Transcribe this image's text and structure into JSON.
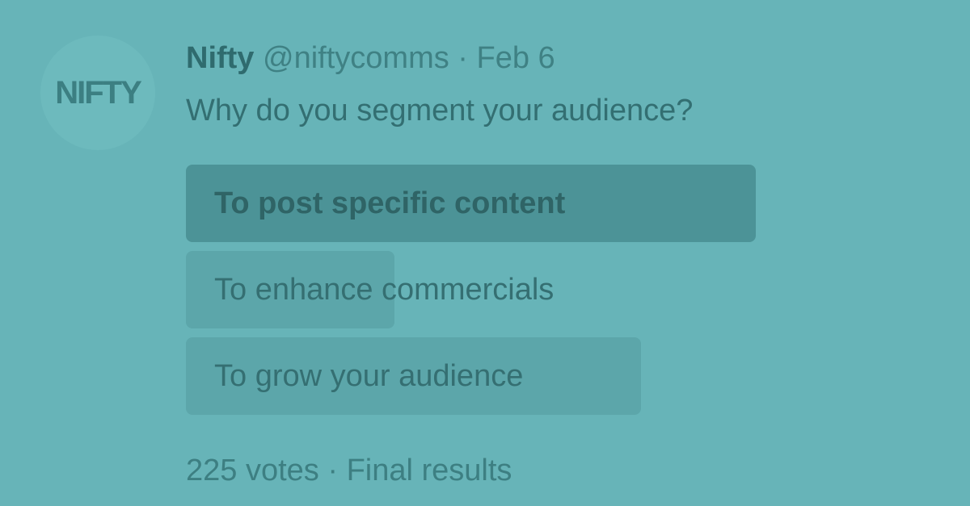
{
  "avatar": {
    "logo_text": "NIFTY"
  },
  "tweet": {
    "author_name": "Nifty",
    "handle": "@niftycomms",
    "separator": "·",
    "date": "Feb 6",
    "question": "Why do you segment your audience?"
  },
  "poll": {
    "options": [
      {
        "label": "To post specific content",
        "share": 1.0,
        "leader": true
      },
      {
        "label": "To enhance commercials",
        "share": 0.366,
        "leader": false
      },
      {
        "label": "To grow your audience",
        "share": 0.798,
        "leader": false
      }
    ]
  },
  "footer": {
    "votes": "225 votes",
    "separator": "·",
    "status": "Final results"
  }
}
